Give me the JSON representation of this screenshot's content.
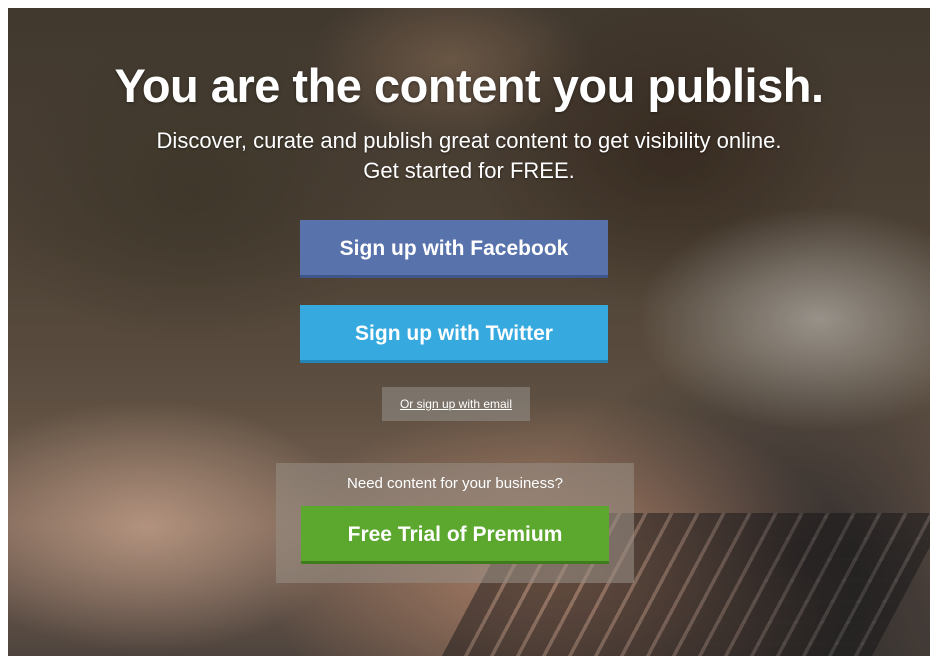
{
  "hero": {
    "headline": "You are the content you publish.",
    "subtitle_line1": "Discover, curate and publish great content to get visibility online.",
    "subtitle_line2": "Get started for FREE."
  },
  "signup": {
    "facebook_label": "Sign up with Facebook",
    "twitter_label": "Sign up with Twitter",
    "email_link": "Or sign up with email"
  },
  "premium": {
    "prompt": "Need content for your business?",
    "button_label": "Free Trial of Premium"
  },
  "colors": {
    "facebook": "#5872ab",
    "twitter": "#36a9df",
    "premium": "#5ca82f"
  }
}
